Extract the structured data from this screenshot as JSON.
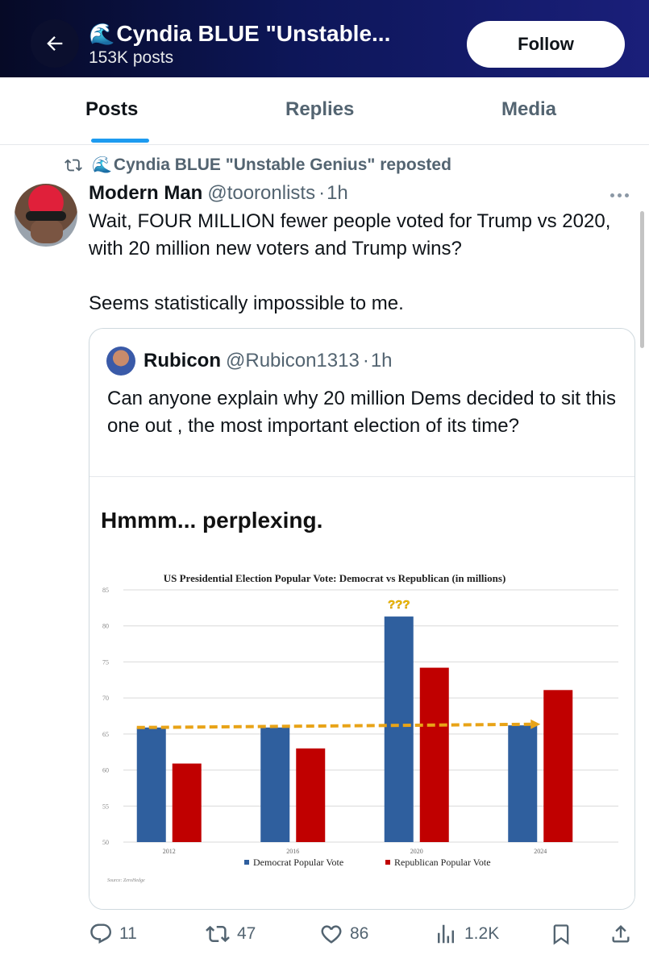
{
  "header": {
    "title": "Cyndia BLUE \"Unstable...",
    "subtitle": "153K posts",
    "follow_label": "Follow",
    "icons": {
      "back": "back-arrow-icon",
      "emoji": "wave-emoji-icon"
    }
  },
  "tabs": [
    {
      "label": "Posts",
      "active": true
    },
    {
      "label": "Replies",
      "active": false
    },
    {
      "label": "Media",
      "active": false
    }
  ],
  "repost": {
    "text": "Cyndia BLUE \"Unstable Genius\" reposted",
    "icon": "repost-icon"
  },
  "tweet": {
    "author_name": "Modern Man",
    "author_handle": "@tooronlists",
    "time": "1h",
    "text_1": "Wait, FOUR MILLION fewer people voted for Trump vs 2020, with 20 million new voters and Trump wins?",
    "text_2": "Seems statistically impossible to me."
  },
  "quote": {
    "author_name": "Rubicon",
    "author_handle": "@Rubicon1313",
    "time": "1h",
    "text": "Can anyone explain why 20 million Dems decided to sit this one out , the most important election of its time?",
    "image_caption": "Hmmm... perplexing."
  },
  "chart_data": {
    "type": "bar",
    "title": "US Presidential Election Popular Vote: Democrat vs Republican (in millions)",
    "categories": [
      "2012",
      "2016",
      "2020",
      "2024"
    ],
    "series": [
      {
        "name": "Democrat Popular Vote",
        "color": "#2f5f9e",
        "values": [
          65.9,
          65.9,
          81.3,
          66.2
        ]
      },
      {
        "name": "Republican Popular Vote",
        "color": "#c00000",
        "values": [
          60.9,
          63.0,
          74.2,
          71.1
        ]
      }
    ],
    "ylim": [
      50,
      85
    ],
    "yticks": [
      "50",
      "55",
      "60",
      "65",
      "70",
      "75",
      "80",
      "85"
    ],
    "annotation": "???",
    "reference_line_value": 65.9,
    "source": "Source: ZeroHedge",
    "grid": true,
    "legend": "bottom"
  },
  "actions": {
    "replies": "11",
    "reposts": "47",
    "likes": "86",
    "views": "1.2K"
  }
}
